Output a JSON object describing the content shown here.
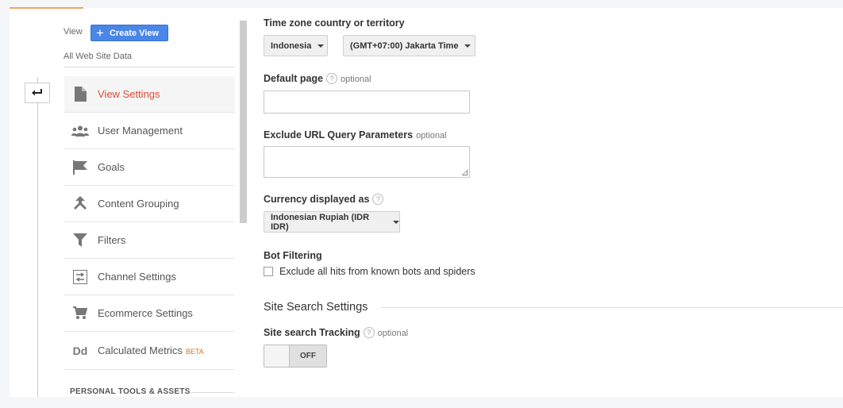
{
  "header": {
    "view_label": "View",
    "create_view_label": "Create View",
    "view_name": "All Web Site Data"
  },
  "sidebar": {
    "items": [
      {
        "label": "View Settings",
        "icon": "document-icon",
        "active": true
      },
      {
        "label": "User Management",
        "icon": "users-icon"
      },
      {
        "label": "Goals",
        "icon": "flag-icon"
      },
      {
        "label": "Content Grouping",
        "icon": "grouping-icon"
      },
      {
        "label": "Filters",
        "icon": "filter-icon"
      },
      {
        "label": "Channel Settings",
        "icon": "channel-icon"
      },
      {
        "label": "Ecommerce Settings",
        "icon": "cart-icon"
      },
      {
        "label": "Calculated Metrics",
        "icon": "dd-icon",
        "badge": "BETA"
      }
    ],
    "section_label": "PERSONAL TOOLS & ASSETS",
    "dd_glyph": "Dd"
  },
  "form": {
    "timezone": {
      "label": "Time zone country or territory",
      "country": "Indonesia",
      "zone": "(GMT+07:00) Jakarta Time"
    },
    "default_page": {
      "label": "Default page",
      "optional": "optional",
      "value": ""
    },
    "exclude_params": {
      "label": "Exclude URL Query Parameters",
      "optional": "optional",
      "value": ""
    },
    "currency": {
      "label": "Currency displayed as",
      "value": "Indonesian Rupiah (IDR IDR)"
    },
    "bot_filtering": {
      "label": "Bot Filtering",
      "checkbox_label": "Exclude all hits from known bots and spiders",
      "checked": false
    },
    "site_search": {
      "section_title": "Site Search Settings",
      "tracking_label": "Site search Tracking",
      "optional": "optional",
      "toggle_state": "OFF"
    },
    "help_glyph": "?"
  },
  "colors": {
    "accent_blue": "#4a86e8",
    "active_red": "#dd4b39",
    "beta_orange": "#e8710a"
  }
}
